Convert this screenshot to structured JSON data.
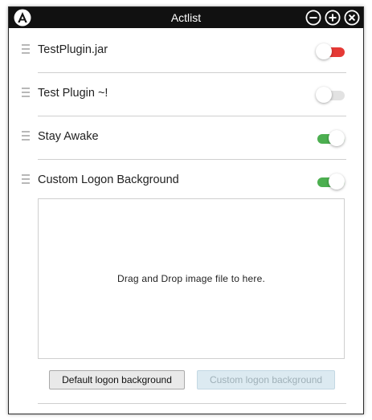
{
  "window": {
    "title": "Actlist",
    "controls": {
      "minimize_icon": "minus-circle-icon",
      "maximize_icon": "plus-circle-icon",
      "close_icon": "close-circle-icon"
    }
  },
  "plugins": [
    {
      "label": "TestPlugin.jar",
      "state": "warning",
      "toggle_color": "#e53935"
    },
    {
      "label": "Test Plugin ~!",
      "state": "off",
      "toggle_color": "#e2e2e2"
    },
    {
      "label": "Stay Awake",
      "state": "on",
      "toggle_color": "#4caf50"
    },
    {
      "label": "Custom Logon Background",
      "state": "on",
      "toggle_color": "#4caf50"
    }
  ],
  "logon": {
    "drop_text": "Drag and Drop image file to here.",
    "default_button": "Default logon background",
    "custom_button": "Custom logon background"
  },
  "colors": {
    "titlebar": "#111111",
    "on": "#4caf50",
    "warning": "#e53935"
  }
}
